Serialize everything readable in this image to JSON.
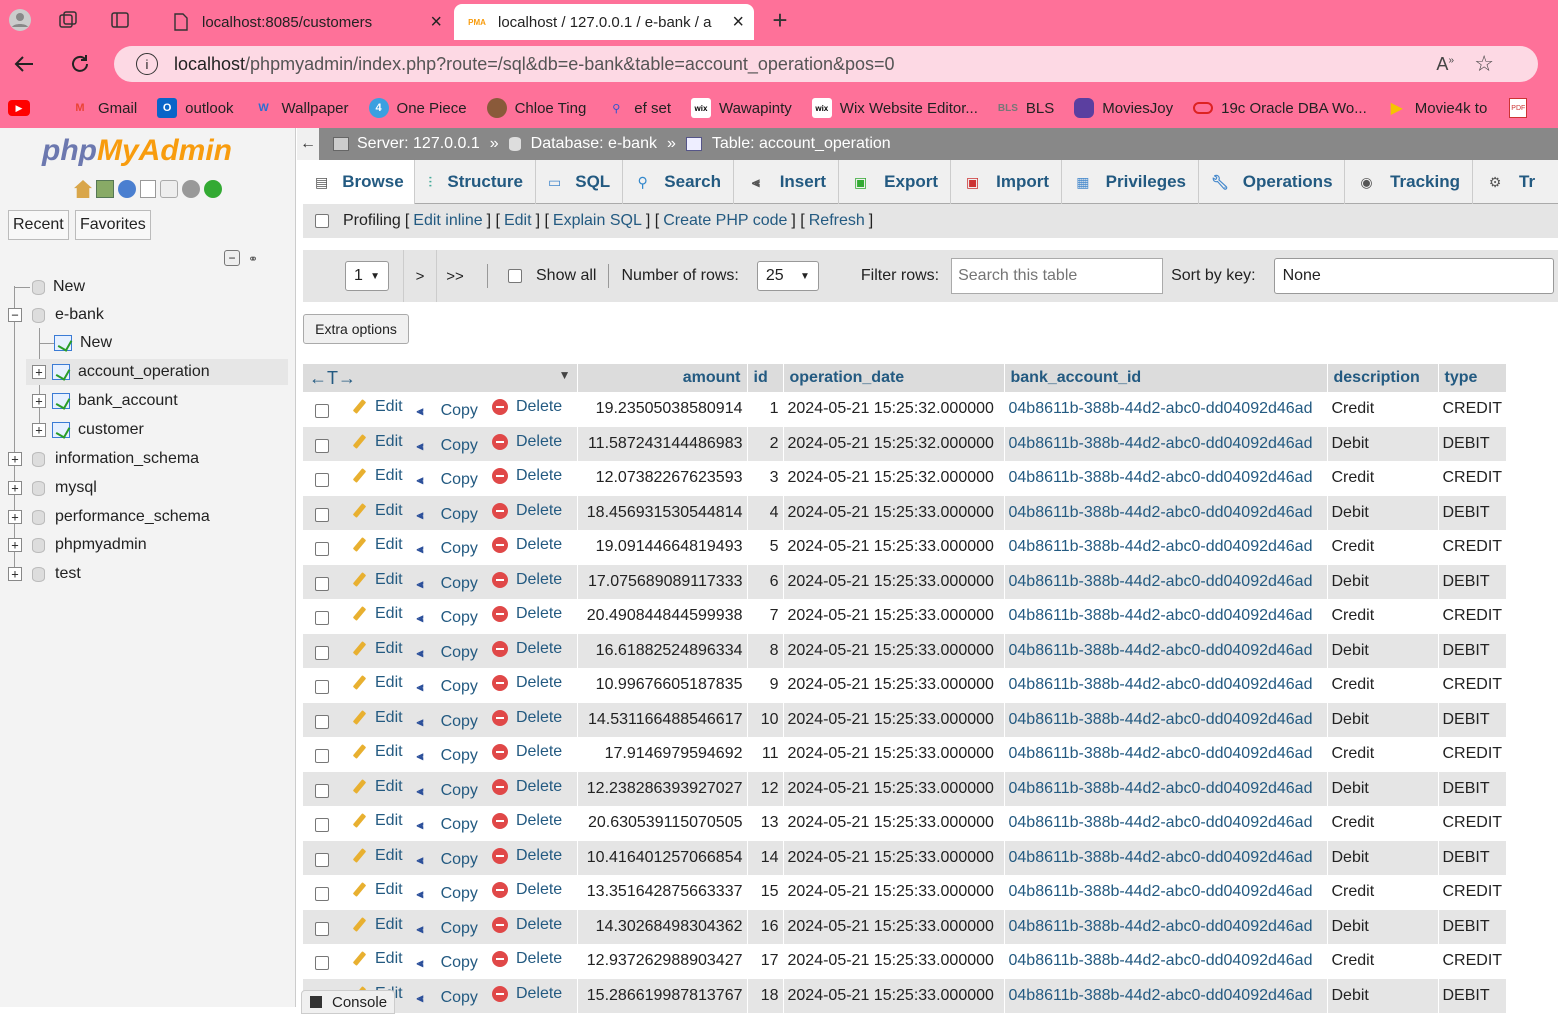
{
  "browser": {
    "tabs": [
      {
        "title": "localhost:8085/customers"
      },
      {
        "title": "localhost / 127.0.0.1 / e-bank / a",
        "favicon": "PMA"
      }
    ],
    "url_host": "localhost",
    "url_path": "/phpmyadmin/index.php?route=/sql&db=e-bank&table=account_operation&pos=0",
    "bookmarks": [
      {
        "label": "Gmail",
        "badge": "M"
      },
      {
        "label": "outlook",
        "badge": "O"
      },
      {
        "label": "Wallpaper",
        "badge": "W"
      },
      {
        "label": "One Piece",
        "badge": "4"
      },
      {
        "label": "Chloe Ting",
        "badge": ""
      },
      {
        "label": "ef set",
        "badge": ""
      },
      {
        "label": "Wawapinty",
        "badge": "wix"
      },
      {
        "label": "Wix Website Editor...",
        "badge": "wix"
      },
      {
        "label": "BLS",
        "badge": "BLS"
      },
      {
        "label": "MoviesJoy",
        "badge": ""
      },
      {
        "label": "19c Oracle DBA Wo...",
        "badge": ""
      },
      {
        "label": "Movie4k to",
        "badge": ""
      }
    ]
  },
  "sidebar": {
    "logo_php": "php",
    "logo_my": "MyAdmin",
    "recent": "Recent",
    "favorites": "Favorites",
    "tree": {
      "new_root": "New",
      "ebank": "e-bank",
      "new_table": "New",
      "account_operation": "account_operation",
      "bank_account": "bank_account",
      "customer": "customer",
      "information_schema": "information_schema",
      "mysql": "mysql",
      "performance_schema": "performance_schema",
      "phpmyadmin": "phpmyadmin",
      "test": "test"
    }
  },
  "breadcrumb": {
    "server": "Server: 127.0.0.1",
    "database": "Database: e-bank",
    "table": "Table: account_operation",
    "sep": "»"
  },
  "tabs": [
    "Browse",
    "Structure",
    "SQL",
    "Search",
    "Insert",
    "Export",
    "Import",
    "Privileges",
    "Operations",
    "Tracking",
    "Tr"
  ],
  "profiling": {
    "label": "Profiling",
    "links": [
      "Edit inline",
      "Edit",
      "Explain SQL",
      "Create PHP code",
      "Refresh"
    ]
  },
  "nav": {
    "page": "1",
    "next": ">",
    "last": ">>",
    "show_all": "Show all",
    "rows_label": "Number of rows:",
    "rows_value": "25",
    "filter_label": "Filter rows:",
    "filter_placeholder": "Search this table",
    "sort_label": "Sort by key:",
    "sort_value": "None"
  },
  "extra_options": "Extra options",
  "table": {
    "columns": [
      "amount",
      "id",
      "operation_date",
      "bank_account_id",
      "description",
      "type"
    ],
    "actions": {
      "edit": "Edit",
      "copy": "Copy",
      "delete": "Delete"
    },
    "rows": [
      {
        "amount": "19.23505038580914",
        "id": "1",
        "date": "2024-05-21 15:25:32.000000",
        "account": "04b8611b-388b-44d2-abc0-dd04092d46ad",
        "description": "Credit",
        "type": "CREDIT"
      },
      {
        "amount": "11.587243144486983",
        "id": "2",
        "date": "2024-05-21 15:25:32.000000",
        "account": "04b8611b-388b-44d2-abc0-dd04092d46ad",
        "description": "Debit",
        "type": "DEBIT"
      },
      {
        "amount": "12.07382267623593",
        "id": "3",
        "date": "2024-05-21 15:25:32.000000",
        "account": "04b8611b-388b-44d2-abc0-dd04092d46ad",
        "description": "Credit",
        "type": "CREDIT"
      },
      {
        "amount": "18.456931530544814",
        "id": "4",
        "date": "2024-05-21 15:25:33.000000",
        "account": "04b8611b-388b-44d2-abc0-dd04092d46ad",
        "description": "Debit",
        "type": "DEBIT"
      },
      {
        "amount": "19.09144664819493",
        "id": "5",
        "date": "2024-05-21 15:25:33.000000",
        "account": "04b8611b-388b-44d2-abc0-dd04092d46ad",
        "description": "Credit",
        "type": "CREDIT"
      },
      {
        "amount": "17.075689089117333",
        "id": "6",
        "date": "2024-05-21 15:25:33.000000",
        "account": "04b8611b-388b-44d2-abc0-dd04092d46ad",
        "description": "Debit",
        "type": "DEBIT"
      },
      {
        "amount": "20.490844844599938",
        "id": "7",
        "date": "2024-05-21 15:25:33.000000",
        "account": "04b8611b-388b-44d2-abc0-dd04092d46ad",
        "description": "Credit",
        "type": "CREDIT"
      },
      {
        "amount": "16.61882524896334",
        "id": "8",
        "date": "2024-05-21 15:25:33.000000",
        "account": "04b8611b-388b-44d2-abc0-dd04092d46ad",
        "description": "Debit",
        "type": "DEBIT"
      },
      {
        "amount": "10.99676605187835",
        "id": "9",
        "date": "2024-05-21 15:25:33.000000",
        "account": "04b8611b-388b-44d2-abc0-dd04092d46ad",
        "description": "Credit",
        "type": "CREDIT"
      },
      {
        "amount": "14.531166488546617",
        "id": "10",
        "date": "2024-05-21 15:25:33.000000",
        "account": "04b8611b-388b-44d2-abc0-dd04092d46ad",
        "description": "Debit",
        "type": "DEBIT"
      },
      {
        "amount": "17.9146979594692",
        "id": "11",
        "date": "2024-05-21 15:25:33.000000",
        "account": "04b8611b-388b-44d2-abc0-dd04092d46ad",
        "description": "Credit",
        "type": "CREDIT"
      },
      {
        "amount": "12.238286393927027",
        "id": "12",
        "date": "2024-05-21 15:25:33.000000",
        "account": "04b8611b-388b-44d2-abc0-dd04092d46ad",
        "description": "Debit",
        "type": "DEBIT"
      },
      {
        "amount": "20.630539115070505",
        "id": "13",
        "date": "2024-05-21 15:25:33.000000",
        "account": "04b8611b-388b-44d2-abc0-dd04092d46ad",
        "description": "Credit",
        "type": "CREDIT"
      },
      {
        "amount": "10.416401257066854",
        "id": "14",
        "date": "2024-05-21 15:25:33.000000",
        "account": "04b8611b-388b-44d2-abc0-dd04092d46ad",
        "description": "Debit",
        "type": "DEBIT"
      },
      {
        "amount": "13.351642875663337",
        "id": "15",
        "date": "2024-05-21 15:25:33.000000",
        "account": "04b8611b-388b-44d2-abc0-dd04092d46ad",
        "description": "Credit",
        "type": "CREDIT"
      },
      {
        "amount": "14.30268498304362",
        "id": "16",
        "date": "2024-05-21 15:25:33.000000",
        "account": "04b8611b-388b-44d2-abc0-dd04092d46ad",
        "description": "Debit",
        "type": "DEBIT"
      },
      {
        "amount": "12.937262988903427",
        "id": "17",
        "date": "2024-05-21 15:25:33.000000",
        "account": "04b8611b-388b-44d2-abc0-dd04092d46ad",
        "description": "Credit",
        "type": "CREDIT"
      },
      {
        "amount": "15.286619987813767",
        "id": "18",
        "date": "2024-05-21 15:25:33.000000",
        "account": "04b8611b-388b-44d2-abc0-dd04092d46ad",
        "description": "Debit",
        "type": "DEBIT"
      }
    ]
  },
  "console": "Console",
  "colors": {
    "browser_accent": "#fe7199",
    "link": "#235a81",
    "row_alt": "#e5e5e5"
  }
}
